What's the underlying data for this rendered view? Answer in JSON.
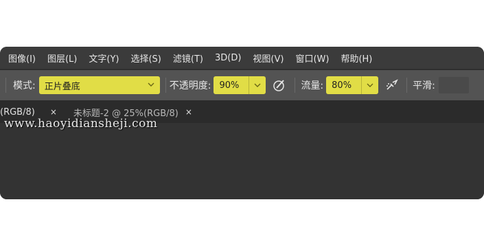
{
  "menu": {
    "items": [
      "图像(I)",
      "图层(L)",
      "文字(Y)",
      "选择(S)",
      "滤镜(T)",
      "3D(D)",
      "视图(V)",
      "窗口(W)",
      "帮助(H)"
    ]
  },
  "options": {
    "mode_label": "模式:",
    "mode_value": "正片叠底",
    "opacity_label": "不透明度:",
    "opacity_value": "90%",
    "flow_label": "流量:",
    "flow_value": "80%",
    "smoothing_label": "平滑:",
    "highlight_color": "#e1dd46"
  },
  "tabs": [
    {
      "label": "(RGB/8)",
      "close": "×"
    },
    {
      "label": "未标题-2 @ 25%(RGB/8)",
      "close": "×"
    }
  ],
  "watermark": "www.haoyidiansheji.com"
}
